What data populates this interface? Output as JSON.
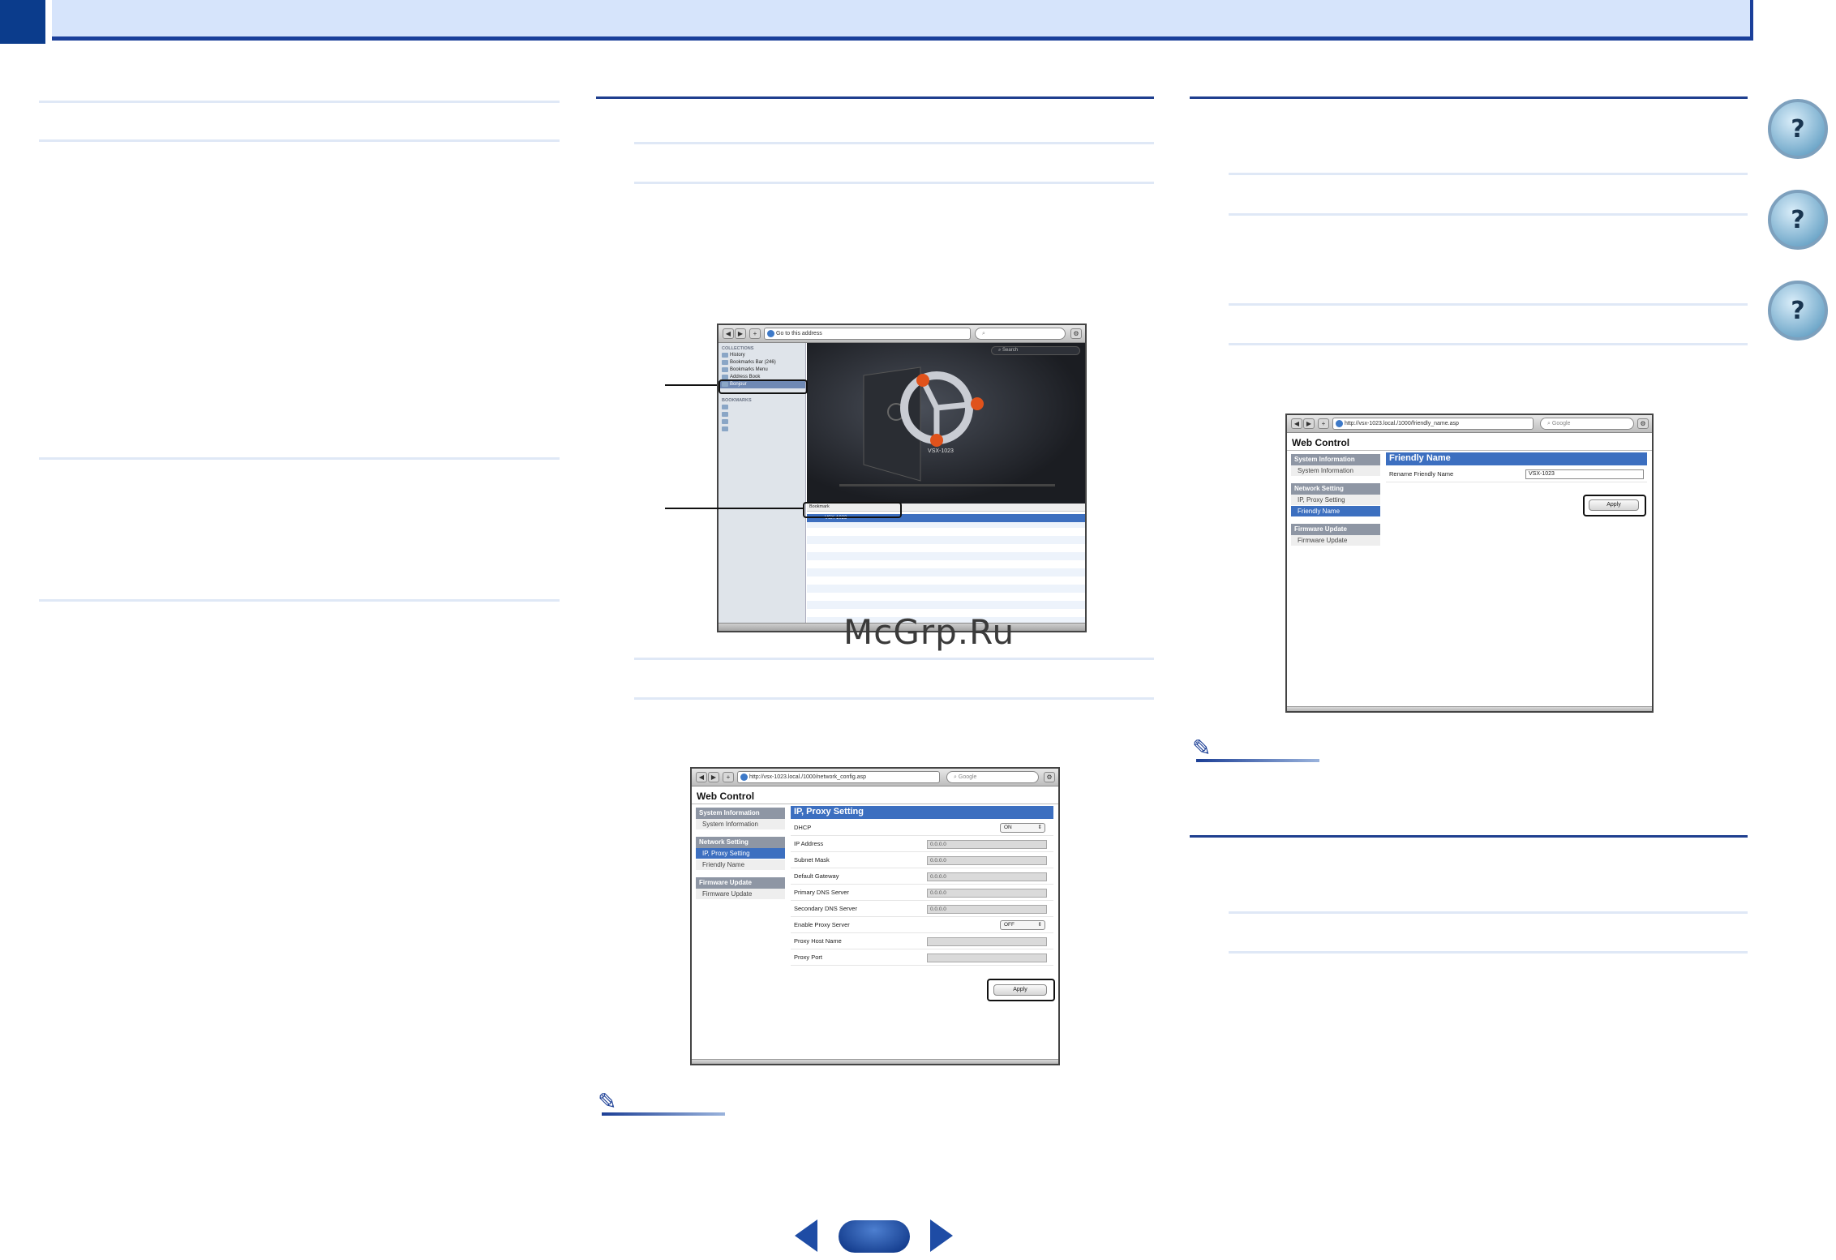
{
  "pager": {
    "page_number": ""
  },
  "watermark": "McGrp.Ru",
  "side_nav": [
    {
      "icon": "book-icon",
      "glyph": "?"
    },
    {
      "icon": "receiver-help-icon",
      "glyph": "?"
    },
    {
      "icon": "remote-help-icon",
      "glyph": "?"
    }
  ],
  "bonjour_browser": {
    "url_text": "Go to this address",
    "search_text": "Search",
    "sidebar_sections": [
      "COLLECTIONS",
      "BOOKMARKS"
    ],
    "sidebar_items": [
      "History",
      "Bookmarks Bar (246)",
      "Bookmarks Menu",
      "Address Book",
      "Bonjour"
    ],
    "device_label": "VSX-1023",
    "list_header": "Bookmark",
    "selected_row": "VSX-1023"
  },
  "network_window": {
    "url": "http://vsx-1023.local./1000/network_config.asp",
    "search_placeholder": "Google",
    "title": "Web Control",
    "sidebar": {
      "cat_system": "System Information",
      "item_system": "System Information",
      "cat_network": "Network Setting",
      "item_ip": "IP, Proxy Setting",
      "item_friendly": "Friendly Name",
      "cat_firmware": "Firmware Update",
      "item_firmware": "Firmware Update"
    },
    "section_title": "IP, Proxy Setting",
    "rows": {
      "dhcp": "DHCP",
      "dhcp_value": "ON",
      "ip": "IP Address",
      "ip_value": "0.0.0.0",
      "subnet": "Subnet Mask",
      "subnet_value": "0.0.0.0",
      "gateway": "Default Gateway",
      "gateway_value": "0.0.0.0",
      "dns1": "Primary DNS Server",
      "dns1_value": "0.0.0.0",
      "dns2": "Secondary DNS Server",
      "dns2_value": "0.0.0.0",
      "proxy": "Enable Proxy Server",
      "proxy_value": "OFF",
      "proxy_host": "Proxy Host Name",
      "proxy_port": "Proxy Port"
    },
    "apply": "Apply"
  },
  "friendly_window": {
    "url": "http://vsx-1023.local./1000/friendly_name.asp",
    "search_placeholder": "Google",
    "title": "Web Control",
    "sidebar": {
      "cat_system": "System Information",
      "item_system": "System Information",
      "cat_network": "Network Setting",
      "item_ip": "IP, Proxy Setting",
      "item_friendly": "Friendly Name",
      "cat_firmware": "Firmware Update",
      "item_firmware": "Firmware Update"
    },
    "section_title": "Friendly Name",
    "rename_label": "Rename Friendly Name",
    "rename_value": "VSX-1023",
    "apply": "Apply"
  },
  "colors": {
    "accent": "#1f3f8f",
    "header_bg": "#d6e4fb",
    "wc_blue": "#3c6fc0"
  }
}
